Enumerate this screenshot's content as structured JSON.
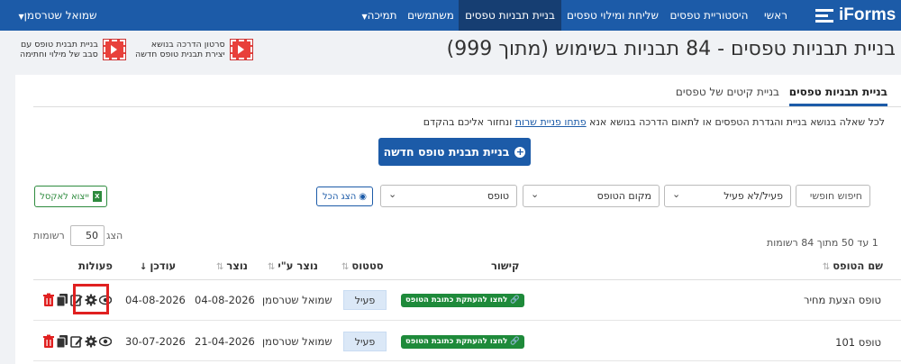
{
  "nav": {
    "logo_text": "iForms",
    "items": [
      "ראשי",
      "היסטוריית טפסים",
      "שליחת ומילוי טפסים",
      "בניית תבניות טפסים",
      "משתמשים",
      "תמיכה"
    ],
    "user_menu": "שמואל שטרסמן"
  },
  "header": {
    "title": "בניית תבניות טפסים - 84 תבניות בשימוש (מתוך 999)",
    "video1_line1": "סרטון הדרכה בנושא",
    "video1_line2": "יצירת תבנית טופס חדשה",
    "video2_line1": "בניית תבנית טופס עם",
    "video2_line2": "סבב של מילוי וחתימה"
  },
  "tabs": [
    "בניית תבניות טפסים",
    "בניית קיטים של טפסים"
  ],
  "help": {
    "prefix": "לכל שאלה בנושא בניית והגדרת הטפסים או לתאום הדרכה בנושא אנא",
    "link": "פתחו פניית שרות",
    "suffix": "ונחזור אליכם בהקדם"
  },
  "new_button": "בניית תבנית טופס חדשה",
  "filters": {
    "search_placeholder": "חיפוש חופשי",
    "active": "פעיל/לא פעיל",
    "location": "מקום הטופס",
    "form": "טופס",
    "show_all": "הצג הכל",
    "export": "ייצוא לאקסל"
  },
  "paging": {
    "count_text": "1 עד 50 מתוך 84 רשומות",
    "show_label": "הצג",
    "page_size": "50",
    "records_label": "רשומות"
  },
  "table": {
    "headers": [
      "שם הטופס",
      "קישור",
      "סטטוס",
      "נוצר ע\"י",
      "נוצר",
      "עודכן",
      "פעולות"
    ],
    "rows": [
      {
        "name": "טופס הצעת מחיר",
        "link": "לחצו להעתקת כתובת הטופס",
        "status": "פעיל",
        "creator": "שמואל שטרסמן",
        "created": "04-08-2026",
        "updated": "04-08-2026"
      },
      {
        "name": "טופס 101",
        "link": "לחצו להעתקת כתובת הטופס",
        "status": "פעיל",
        "creator": "שמואל שטרסמן",
        "created": "21-04-2026",
        "updated": "30-07-2026"
      }
    ]
  },
  "colors": {
    "brand": "#1c5ba8",
    "nav_active": "#163e72",
    "badge_green": "#1e8a3a",
    "delete_red": "#e02020"
  }
}
